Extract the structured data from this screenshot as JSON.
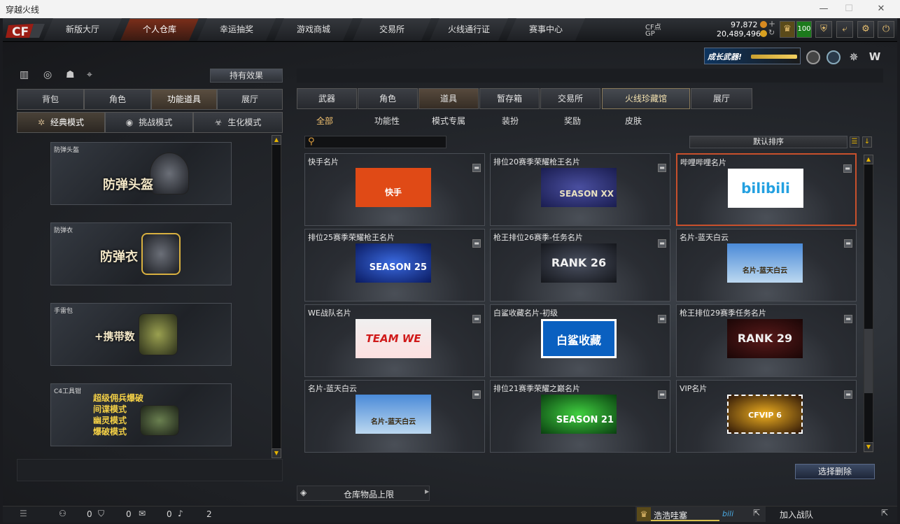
{
  "window": {
    "title": "穿越火线",
    "minimize": "—",
    "maximize": "☐",
    "close": "✕"
  },
  "nav": {
    "tabs": [
      "新版大厅",
      "个人仓库",
      "幸运抽奖",
      "游戏商城",
      "交易所",
      "火线通行证",
      "赛事中心"
    ],
    "active_index": 1
  },
  "currency": {
    "cf_label": "CF点",
    "cf_value": "97,872",
    "gp_label": "GP",
    "gp_value": "20,489,496",
    "level": "100"
  },
  "growth_weapon_banner": "成长武器!",
  "left": {
    "effect_button": "持有效果",
    "tabs": [
      "背包",
      "角色",
      "功能道具",
      "展厅"
    ],
    "active_tab_index": 2,
    "modes": [
      "经典模式",
      "挑战模式",
      "生化模式"
    ],
    "active_mode_index": 0,
    "cards": [
      {
        "label": "防弹头盔",
        "big": "防弹头盔"
      },
      {
        "label": "防弹衣",
        "big": "防弹衣"
      },
      {
        "label": "手雷包",
        "big": "+携带数"
      },
      {
        "label": "C4工具钳",
        "lines": [
          "超级佣兵爆破",
          "间谍模式",
          "幽灵模式",
          "爆破模式"
        ]
      }
    ]
  },
  "right": {
    "tabs": [
      "武器",
      "角色",
      "道具",
      "暂存箱",
      "交易所",
      "火线珍藏馆",
      "展厅"
    ],
    "active_tab_index": 2,
    "special_tab_index": 5,
    "subtabs": [
      "全部",
      "功能性",
      "模式专属",
      "装扮",
      "奖励",
      "皮肤"
    ],
    "active_subtab_index": 0,
    "search_placeholder": "",
    "sort_label": "默认排序",
    "items": [
      {
        "name": "快手名片",
        "img_text": "快手"
      },
      {
        "name": "排位20赛季荣耀枪王名片",
        "img_text": "SEASON XX"
      },
      {
        "name": "哔哩哔哩名片",
        "img_text": "bilibili"
      },
      {
        "name": "排位25赛季荣耀枪王名片",
        "img_text": "SEASON 25"
      },
      {
        "name": "枪王排位26赛季-任务名片",
        "img_text": "RANK 26"
      },
      {
        "name": "名片-蓝天白云",
        "img_text": "名片-蓝天白云"
      },
      {
        "name": "WE战队名片",
        "img_text": "TEAM WE"
      },
      {
        "name": "白鲨收藏名片-初级",
        "img_text": "白鲨收藏"
      },
      {
        "name": "枪王排位29赛季任务名片",
        "img_text": "RANK 29"
      },
      {
        "name": "名片-蓝天白云",
        "img_text": "名片-蓝天白云"
      },
      {
        "name": "排位21赛季荣耀之巅名片",
        "img_text": "SEASON 21"
      },
      {
        "name": "VIP名片",
        "img_text": "CFVIP 6"
      }
    ],
    "selected_index": 2,
    "delete_button": "选择删除",
    "storage_limit": "仓库物品上限"
  },
  "bottom": {
    "friends_count": "0",
    "shield_count": "0",
    "chat_count": "0",
    "volume": "2",
    "player_name": "浩浩哇塞",
    "join_team": "加入战队"
  }
}
